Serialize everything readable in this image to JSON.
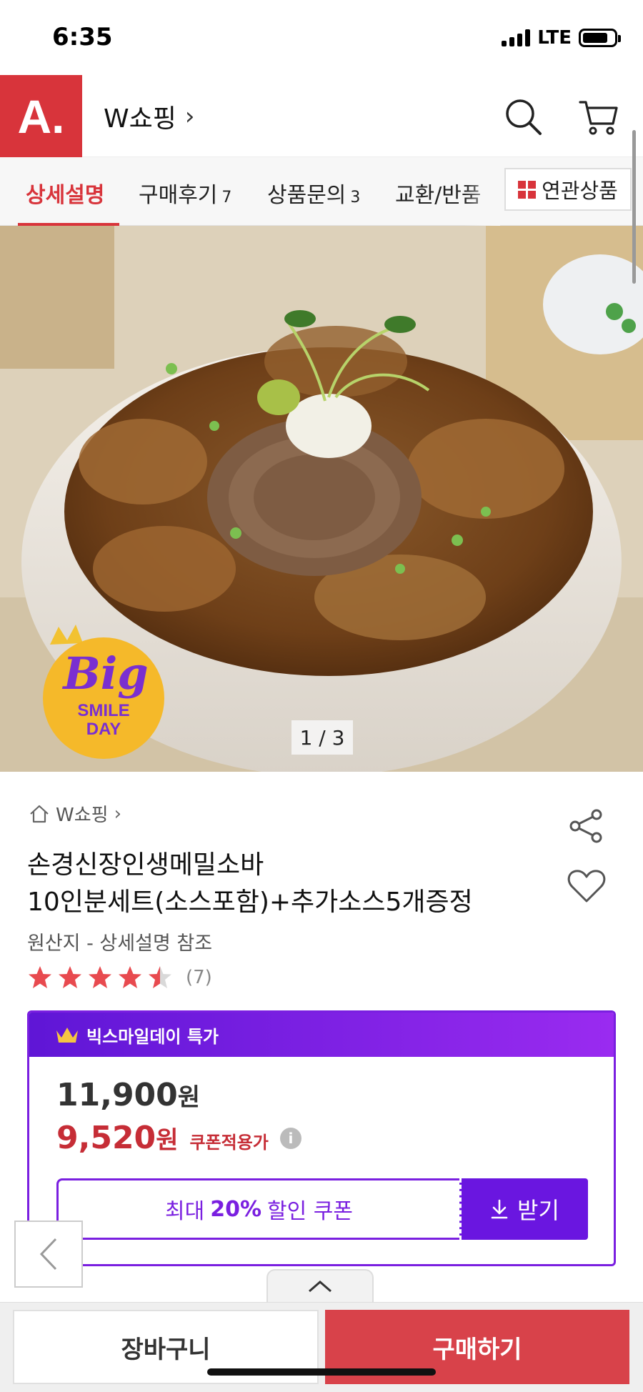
{
  "status_bar": {
    "time": "6:35",
    "network": "LTE"
  },
  "header": {
    "logo_text": "A.",
    "store_name": "W쇼핑",
    "store_chevron": "›"
  },
  "tabs": [
    {
      "label": "상세설명",
      "count": "",
      "active": true
    },
    {
      "label": "구매후기",
      "count": "7",
      "active": false
    },
    {
      "label": "상품문의",
      "count": "3",
      "active": false
    },
    {
      "label": "교환/반품",
      "count": "",
      "active": false
    }
  ],
  "related_button": {
    "label": "연관상품"
  },
  "hero": {
    "page_indicator": "1 / 3",
    "badge": {
      "word": "Big",
      "line1": "SMILE",
      "line2": "DAY"
    }
  },
  "product": {
    "breadcrumb": "W쇼핑",
    "title_line1": "손경신장인생메밀소바",
    "title_line2": "10인분세트(소스포함)+추가소스5개증정",
    "origin": "원산지 - 상세설명 참조",
    "rating": 4.5,
    "review_count": "(7)"
  },
  "promo": {
    "header": "빅스마일데이 특가",
    "original_price": "11,900",
    "sale_price": "9,520",
    "currency": "원",
    "coupon_applied_label": "쿠폰적용가",
    "coupon_text_prefix": "최대",
    "coupon_percent": "20%",
    "coupon_text_suffix": "할인 쿠폰",
    "coupon_button": "받기"
  },
  "bottom_bar": {
    "cart_label": "장바구니",
    "buy_label": "구매하기"
  },
  "colors": {
    "brand_red": "#d8343b",
    "promo_purple": "#7a1fe0",
    "sale_red": "#c62d36"
  }
}
